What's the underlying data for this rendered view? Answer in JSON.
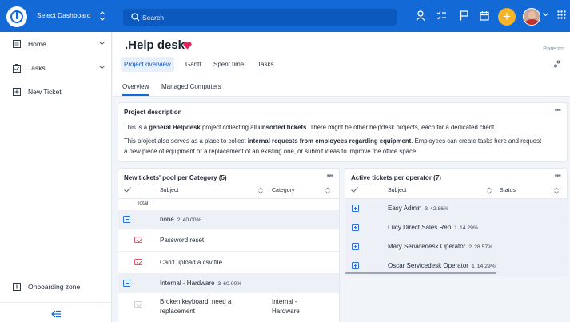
{
  "topbar": {
    "dashboard_select": "Select Dashboard",
    "search_placeholder": "Search",
    "plus": "+",
    "colors": {
      "bar": "#1369d6",
      "accent": "#f5b42a"
    }
  },
  "sidebar": {
    "items": [
      {
        "label": "Home",
        "icon": "home-icon"
      },
      {
        "label": "Tasks",
        "icon": "tasks-icon"
      },
      {
        "label": "New Ticket",
        "icon": "plus-box-icon"
      }
    ],
    "onboarding": "Onboarding zone"
  },
  "header": {
    "title": ".Help desk",
    "parents": "Parents:",
    "tabs": [
      "Project overview",
      "Gantt",
      "Spent time",
      "Tasks"
    ],
    "subtabs": [
      "Overview",
      "Managed Computers"
    ]
  },
  "description": {
    "title": "Project description",
    "line1_a": "This is a ",
    "line1_b": "general Helpdesk",
    "line1_c": " project collecting all ",
    "line1_d": "unsorted tickets",
    "line1_e": ". There might be other helpdesk projects, each for a dedicated client.",
    "line2_a": "This project also serves as a place to collect ",
    "line2_b": "internal requests from employees regarding equipment",
    "line2_c": ". Employees can create tasks here and request",
    "line3": "a new piece of equipment or a replacement of an existing one, or submit ideas to improve the office space.",
    "dots": "•••"
  },
  "pool": {
    "title": "New tickets' pool per Category (5)",
    "dots": "•••",
    "col_subject": "Subject",
    "col_category": "Category",
    "total": "Total:",
    "groups": [
      {
        "name": "none",
        "count": "2",
        "pct": "40.00%"
      },
      {
        "name": "Internal - Hardware",
        "count": "3",
        "pct": "60.00%"
      }
    ],
    "rows": [
      {
        "subject": "Password reset",
        "category": ""
      },
      {
        "subject": "Can't upload a csv file",
        "category": ""
      },
      {
        "subject_l1": "Broken keyboard, need a",
        "subject_l2": "replacement",
        "category_l1": "Internal -",
        "category_l2": "Hardware"
      }
    ]
  },
  "operators": {
    "title": "Active tickets per operator (7)",
    "dots": "•••",
    "col_subject": "Subject",
    "col_status": "Status",
    "rows": [
      {
        "name": "Easy Admin",
        "count": "3",
        "pct": "42.86%"
      },
      {
        "name": "Lucy Direct Sales Rep",
        "count": "1",
        "pct": "14.29%"
      },
      {
        "name": "Mary Servicedesk Operator",
        "count": "2",
        "pct": "28.57%"
      },
      {
        "name": "Oscar Servicedesk Operator",
        "count": "1",
        "pct": "14.29%"
      }
    ]
  }
}
